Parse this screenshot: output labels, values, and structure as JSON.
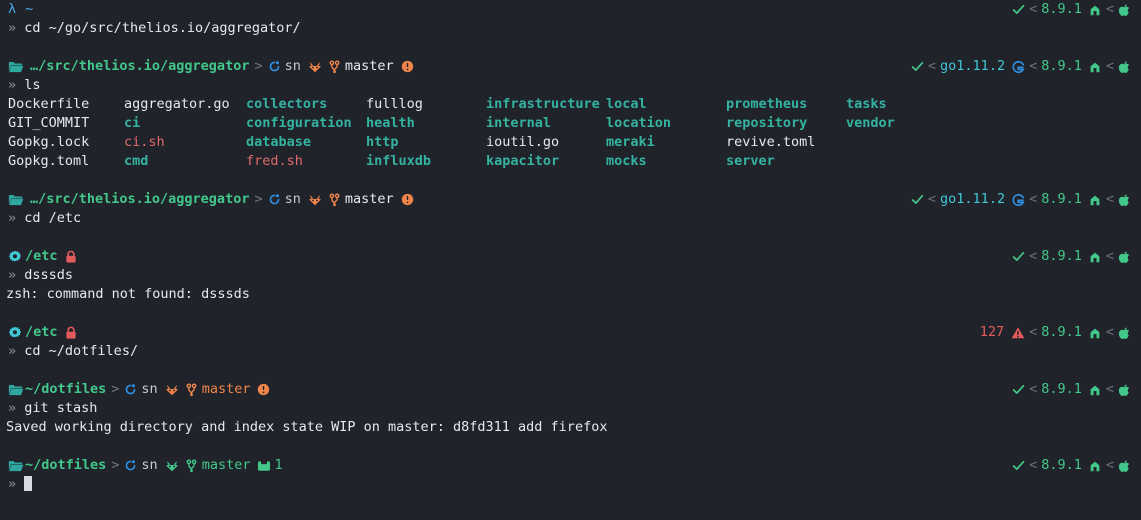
{
  "theme": {
    "background": "#21232b",
    "foreground": "#dfe2e8",
    "green": "#42c88a",
    "teal": "#3fb995",
    "dir_teal": "#34b4a0",
    "cyan": "#41c6d4",
    "blue": "#2f8fe0",
    "orange": "#f0854a",
    "red": "#e35b5b",
    "grey": "#9aa0ab",
    "dim": "#6b7280",
    "cursor": "#d8dbe2"
  },
  "status": {
    "ok_check": "✔",
    "separator": "<",
    "node_version": "8.9.1",
    "go_version": "go1.11.2",
    "exit_code_127": "127"
  },
  "blocks": {
    "b1": {
      "prompt": {
        "lambda": "λ",
        "path": "~"
      },
      "command": "cd ~/go/src/thelios.io/aggregator/",
      "prompt_char": "»"
    },
    "b2": {
      "prompt": {
        "path": "…/src/thelios.io/aggregator",
        "sep": ">",
        "vcs_label": "sn",
        "branch": "master"
      },
      "command": "ls",
      "prompt_char": "»"
    },
    "b3": {
      "prompt": {
        "path": "…/src/thelios.io/aggregator",
        "sep": ">",
        "vcs_label": "sn",
        "branch": "master"
      },
      "command": "cd /etc",
      "prompt_char": "»"
    },
    "b4": {
      "prompt": {
        "path": "/etc"
      },
      "command": "dsssds",
      "prompt_char": "»",
      "output": "zsh: command not found: dsssds"
    },
    "b5": {
      "prompt": {
        "path": "/etc"
      },
      "command": "cd ~/dotfiles/",
      "prompt_char": "»"
    },
    "b6": {
      "prompt": {
        "path": "~/dotfiles",
        "sep": ">",
        "vcs_label": "sn",
        "branch": "master"
      },
      "command": "git stash",
      "prompt_char": "»",
      "output": "Saved working directory and index state WIP on master: d8fd311 add firefox"
    },
    "b7": {
      "prompt": {
        "path": "~/dotfiles",
        "sep": ">",
        "vcs_label": "sn",
        "branch": "master",
        "stash_count": "1"
      },
      "command": "",
      "prompt_char": "»"
    }
  },
  "ls_output": {
    "columns": [
      [
        {
          "name": "Dockerfile",
          "kind": "file"
        },
        {
          "name": "GIT_COMMIT",
          "kind": "file"
        },
        {
          "name": "Gopkg.lock",
          "kind": "file"
        },
        {
          "name": "Gopkg.toml",
          "kind": "file"
        }
      ],
      [
        {
          "name": "aggregator.go",
          "kind": "file"
        },
        {
          "name": "ci",
          "kind": "dir"
        },
        {
          "name": "ci.sh",
          "kind": "exec"
        },
        {
          "name": "cmd",
          "kind": "dir"
        }
      ],
      [
        {
          "name": "collectors",
          "kind": "dir"
        },
        {
          "name": "configuration",
          "kind": "dir"
        },
        {
          "name": "database",
          "kind": "dir"
        },
        {
          "name": "fred.sh",
          "kind": "exec"
        }
      ],
      [
        {
          "name": "fulllog",
          "kind": "file"
        },
        {
          "name": "health",
          "kind": "dir"
        },
        {
          "name": "http",
          "kind": "dir"
        },
        {
          "name": "influxdb",
          "kind": "dir"
        }
      ],
      [
        {
          "name": "infrastructure",
          "kind": "dir"
        },
        {
          "name": "internal",
          "kind": "dir"
        },
        {
          "name": "ioutil.go",
          "kind": "file"
        },
        {
          "name": "kapacitor",
          "kind": "dir"
        }
      ],
      [
        {
          "name": "local",
          "kind": "dir"
        },
        {
          "name": "location",
          "kind": "dir"
        },
        {
          "name": "meraki",
          "kind": "dir"
        },
        {
          "name": "mocks",
          "kind": "dir"
        }
      ],
      [
        {
          "name": "prometheus",
          "kind": "dir"
        },
        {
          "name": "repository",
          "kind": "dir"
        },
        {
          "name": "revive.toml",
          "kind": "file"
        },
        {
          "name": "server",
          "kind": "dir"
        }
      ],
      [
        {
          "name": "tasks",
          "kind": "dir"
        },
        {
          "name": "vendor",
          "kind": "dir"
        }
      ]
    ]
  },
  "icons": {
    "folder": "folder-icon",
    "gear": "gear-icon",
    "lock": "lock-icon",
    "refresh": "refresh-icon",
    "gitlab_fox": "gitlab-fox-icon",
    "branch": "git-branch-icon",
    "alert_circle": "alert-circle-icon",
    "warning_triangle": "warning-triangle-icon",
    "check": "check-icon",
    "node": "node-home-icon",
    "apple": "apple-icon",
    "go_gopher": "go-logo-icon",
    "stash_box": "stash-box-icon"
  }
}
